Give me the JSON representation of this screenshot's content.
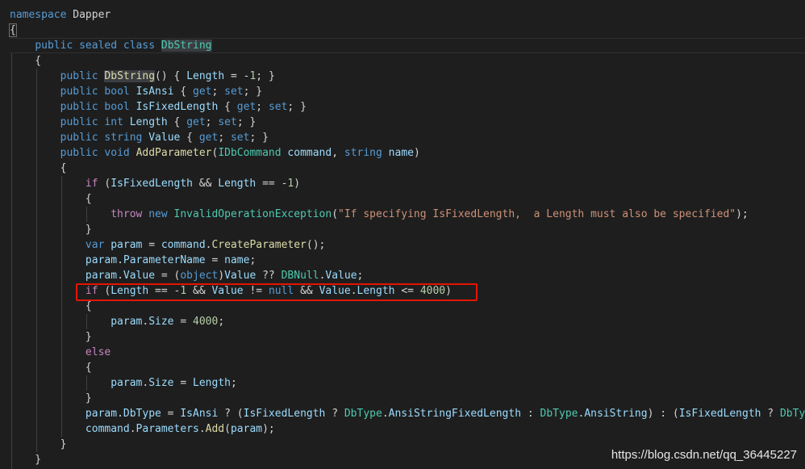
{
  "editor": {
    "lines": [
      [
        {
          "t": "namespace ",
          "c": "kw"
        },
        {
          "t": "Dapper",
          "c": "p"
        }
      ],
      [
        {
          "t": "{",
          "c": "p",
          "brace": true
        }
      ],
      [
        {
          "t": "    "
        },
        {
          "t": "public",
          "c": "kw"
        },
        {
          "t": " "
        },
        {
          "t": "sealed",
          "c": "kw"
        },
        {
          "t": " "
        },
        {
          "t": "class",
          "c": "kw"
        },
        {
          "t": " "
        },
        {
          "t": "DbString",
          "c": "ty",
          "hl": true
        }
      ],
      [
        {
          "t": "    {",
          "c": "p"
        }
      ],
      [
        {
          "t": "        "
        },
        {
          "t": "public",
          "c": "kw"
        },
        {
          "t": " "
        },
        {
          "t": "DbString",
          "c": "fn",
          "hl": true
        },
        {
          "t": "() { ",
          "c": "p"
        },
        {
          "t": "Length",
          "c": "id"
        },
        {
          "t": " = -",
          "c": "p"
        },
        {
          "t": "1",
          "c": "num"
        },
        {
          "t": "; }",
          "c": "p"
        }
      ],
      [
        {
          "t": "        "
        },
        {
          "t": "public",
          "c": "kw"
        },
        {
          "t": " "
        },
        {
          "t": "bool",
          "c": "kw"
        },
        {
          "t": " "
        },
        {
          "t": "IsAnsi",
          "c": "id"
        },
        {
          "t": " { ",
          "c": "p"
        },
        {
          "t": "get",
          "c": "kw"
        },
        {
          "t": "; ",
          "c": "p"
        },
        {
          "t": "set",
          "c": "kw"
        },
        {
          "t": "; }",
          "c": "p"
        }
      ],
      [
        {
          "t": "        "
        },
        {
          "t": "public",
          "c": "kw"
        },
        {
          "t": " "
        },
        {
          "t": "bool",
          "c": "kw"
        },
        {
          "t": " "
        },
        {
          "t": "IsFixedLength",
          "c": "id"
        },
        {
          "t": " { ",
          "c": "p"
        },
        {
          "t": "get",
          "c": "kw"
        },
        {
          "t": "; ",
          "c": "p"
        },
        {
          "t": "set",
          "c": "kw"
        },
        {
          "t": "; }",
          "c": "p"
        }
      ],
      [
        {
          "t": "        "
        },
        {
          "t": "public",
          "c": "kw"
        },
        {
          "t": " "
        },
        {
          "t": "int",
          "c": "kw"
        },
        {
          "t": " "
        },
        {
          "t": "Length",
          "c": "id"
        },
        {
          "t": " { ",
          "c": "p"
        },
        {
          "t": "get",
          "c": "kw"
        },
        {
          "t": "; ",
          "c": "p"
        },
        {
          "t": "set",
          "c": "kw"
        },
        {
          "t": "; }",
          "c": "p"
        }
      ],
      [
        {
          "t": "        "
        },
        {
          "t": "public",
          "c": "kw"
        },
        {
          "t": " "
        },
        {
          "t": "string",
          "c": "kw"
        },
        {
          "t": " "
        },
        {
          "t": "Value",
          "c": "id"
        },
        {
          "t": " { ",
          "c": "p"
        },
        {
          "t": "get",
          "c": "kw"
        },
        {
          "t": "; ",
          "c": "p"
        },
        {
          "t": "set",
          "c": "kw"
        },
        {
          "t": "; }",
          "c": "p"
        }
      ],
      [
        {
          "t": "        "
        },
        {
          "t": "public",
          "c": "kw"
        },
        {
          "t": " "
        },
        {
          "t": "void",
          "c": "kw"
        },
        {
          "t": " "
        },
        {
          "t": "AddParameter",
          "c": "fn"
        },
        {
          "t": "(",
          "c": "p"
        },
        {
          "t": "IDbCommand",
          "c": "ty"
        },
        {
          "t": " "
        },
        {
          "t": "command",
          "c": "id"
        },
        {
          "t": ", ",
          "c": "p"
        },
        {
          "t": "string",
          "c": "kw"
        },
        {
          "t": " "
        },
        {
          "t": "name",
          "c": "id"
        },
        {
          "t": ")",
          "c": "p"
        }
      ],
      [
        {
          "t": "        {",
          "c": "p"
        }
      ],
      [
        {
          "t": "            "
        },
        {
          "t": "if",
          "c": "ctl"
        },
        {
          "t": " (",
          "c": "p"
        },
        {
          "t": "IsFixedLength",
          "c": "id"
        },
        {
          "t": " && ",
          "c": "p"
        },
        {
          "t": "Length",
          "c": "id"
        },
        {
          "t": " == -",
          "c": "p"
        },
        {
          "t": "1",
          "c": "num"
        },
        {
          "t": ")",
          "c": "p"
        }
      ],
      [
        {
          "t": "            {",
          "c": "p"
        }
      ],
      [
        {
          "t": "                "
        },
        {
          "t": "throw",
          "c": "ctl"
        },
        {
          "t": " "
        },
        {
          "t": "new",
          "c": "kw"
        },
        {
          "t": " "
        },
        {
          "t": "InvalidOperationException",
          "c": "ty"
        },
        {
          "t": "(",
          "c": "p"
        },
        {
          "t": "\"If specifying IsFixedLength,  a Length must also be specified\"",
          "c": "str"
        },
        {
          "t": ");",
          "c": "p"
        }
      ],
      [
        {
          "t": "            }",
          "c": "p"
        }
      ],
      [
        {
          "t": "            "
        },
        {
          "t": "var",
          "c": "kw"
        },
        {
          "t": " "
        },
        {
          "t": "param",
          "c": "id"
        },
        {
          "t": " = ",
          "c": "p"
        },
        {
          "t": "command",
          "c": "id"
        },
        {
          "t": ".",
          "c": "p"
        },
        {
          "t": "CreateParameter",
          "c": "fn"
        },
        {
          "t": "();",
          "c": "p"
        }
      ],
      [
        {
          "t": "            "
        },
        {
          "t": "param",
          "c": "id"
        },
        {
          "t": ".",
          "c": "p"
        },
        {
          "t": "ParameterName",
          "c": "id"
        },
        {
          "t": " = ",
          "c": "p"
        },
        {
          "t": "name",
          "c": "id"
        },
        {
          "t": ";",
          "c": "p"
        }
      ],
      [
        {
          "t": "            "
        },
        {
          "t": "param",
          "c": "id"
        },
        {
          "t": ".",
          "c": "p"
        },
        {
          "t": "Value",
          "c": "id"
        },
        {
          "t": " = (",
          "c": "p"
        },
        {
          "t": "object",
          "c": "kw"
        },
        {
          "t": ")",
          "c": "p"
        },
        {
          "t": "Value",
          "c": "id"
        },
        {
          "t": " ?? ",
          "c": "p"
        },
        {
          "t": "DBNull",
          "c": "ty"
        },
        {
          "t": ".",
          "c": "p"
        },
        {
          "t": "Value",
          "c": "id"
        },
        {
          "t": ";",
          "c": "p"
        }
      ],
      [
        {
          "t": "            "
        },
        {
          "t": "if",
          "c": "ctl"
        },
        {
          "t": " (",
          "c": "p"
        },
        {
          "t": "Length",
          "c": "id"
        },
        {
          "t": " == -",
          "c": "p"
        },
        {
          "t": "1",
          "c": "num"
        },
        {
          "t": " && ",
          "c": "p"
        },
        {
          "t": "Value",
          "c": "id"
        },
        {
          "t": " != ",
          "c": "p"
        },
        {
          "t": "null",
          "c": "kw"
        },
        {
          "t": " && ",
          "c": "p"
        },
        {
          "t": "Value",
          "c": "id"
        },
        {
          "t": ".",
          "c": "p"
        },
        {
          "t": "Length",
          "c": "id"
        },
        {
          "t": " <= ",
          "c": "p"
        },
        {
          "t": "4000",
          "c": "num"
        },
        {
          "t": ")",
          "c": "p"
        }
      ],
      [
        {
          "t": "            {",
          "c": "p"
        }
      ],
      [
        {
          "t": "                "
        },
        {
          "t": "param",
          "c": "id"
        },
        {
          "t": ".",
          "c": "p"
        },
        {
          "t": "Size",
          "c": "id"
        },
        {
          "t": " = ",
          "c": "p"
        },
        {
          "t": "4000",
          "c": "num"
        },
        {
          "t": ";",
          "c": "p"
        }
      ],
      [
        {
          "t": "            }",
          "c": "p"
        }
      ],
      [
        {
          "t": "            "
        },
        {
          "t": "else",
          "c": "ctl"
        }
      ],
      [
        {
          "t": "            {",
          "c": "p"
        }
      ],
      [
        {
          "t": "                "
        },
        {
          "t": "param",
          "c": "id"
        },
        {
          "t": ".",
          "c": "p"
        },
        {
          "t": "Size",
          "c": "id"
        },
        {
          "t": " = ",
          "c": "p"
        },
        {
          "t": "Length",
          "c": "id"
        },
        {
          "t": ";",
          "c": "p"
        }
      ],
      [
        {
          "t": "            }",
          "c": "p"
        }
      ],
      [
        {
          "t": "            "
        },
        {
          "t": "param",
          "c": "id"
        },
        {
          "t": ".",
          "c": "p"
        },
        {
          "t": "DbType",
          "c": "id"
        },
        {
          "t": " = ",
          "c": "p"
        },
        {
          "t": "IsAnsi",
          "c": "id"
        },
        {
          "t": " ? (",
          "c": "p"
        },
        {
          "t": "IsFixedLength",
          "c": "id"
        },
        {
          "t": " ? ",
          "c": "p"
        },
        {
          "t": "DbType",
          "c": "ty"
        },
        {
          "t": ".",
          "c": "p"
        },
        {
          "t": "AnsiStringFixedLength",
          "c": "id"
        },
        {
          "t": " : ",
          "c": "p"
        },
        {
          "t": "DbType",
          "c": "ty"
        },
        {
          "t": ".",
          "c": "p"
        },
        {
          "t": "AnsiString",
          "c": "id"
        },
        {
          "t": ") : (",
          "c": "p"
        },
        {
          "t": "IsFixedLength",
          "c": "id"
        },
        {
          "t": " ? ",
          "c": "p"
        },
        {
          "t": "DbType",
          "c": "ty"
        }
      ],
      [
        {
          "t": "            "
        },
        {
          "t": "command",
          "c": "id"
        },
        {
          "t": ".",
          "c": "p"
        },
        {
          "t": "Parameters",
          "c": "id"
        },
        {
          "t": ".",
          "c": "p"
        },
        {
          "t": "Add",
          "c": "fn"
        },
        {
          "t": "(",
          "c": "p"
        },
        {
          "t": "param",
          "c": "id"
        },
        {
          "t": ");",
          "c": "p"
        }
      ],
      [
        {
          "t": "        }",
          "c": "p"
        }
      ],
      [
        {
          "t": "    }",
          "c": "p"
        }
      ]
    ]
  },
  "colors": {
    "background": "#1e1e1e",
    "keyword": "#569cd6",
    "control": "#c586c0",
    "type": "#4ec9b0",
    "function": "#dcdcaa",
    "identifier": "#9cdcfe",
    "number": "#b5cea8",
    "string": "#ce9178",
    "punctuation": "#d4d4d4",
    "highlight_box": "#e51400"
  },
  "watermark": "https://blog.csdn.net/qq_36445227"
}
